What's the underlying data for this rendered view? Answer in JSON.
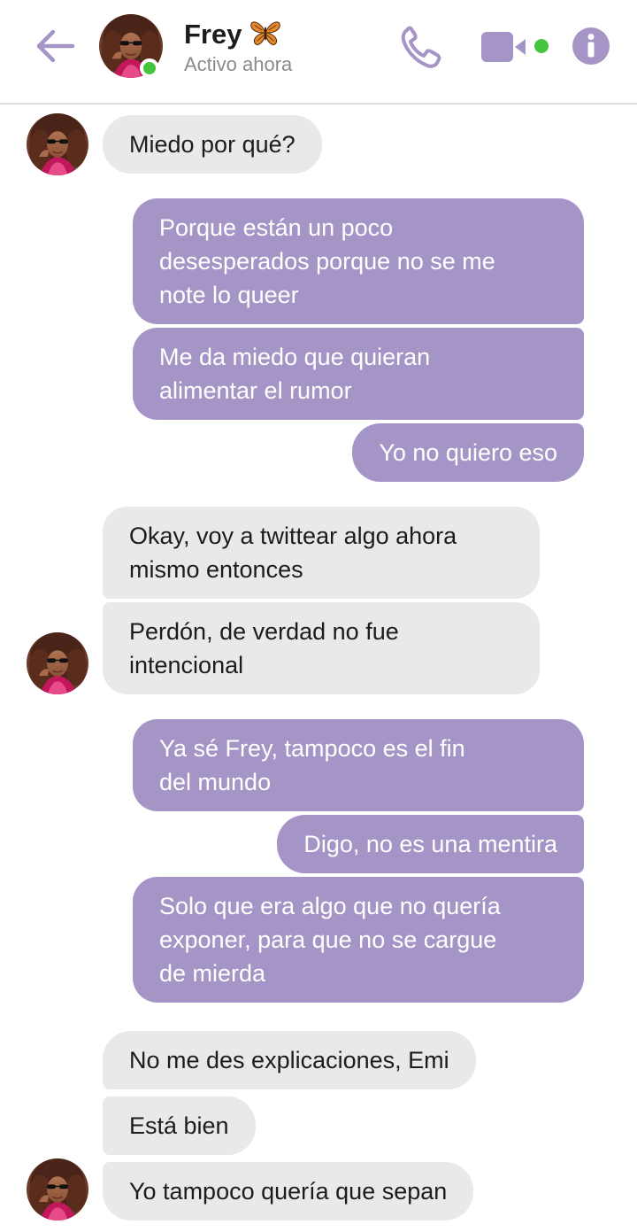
{
  "header": {
    "contact_name": "Frey",
    "status": "Activo ahora",
    "accent_color": "#a595c6",
    "online_color": "#45c43e",
    "icons": [
      "back-arrow-icon",
      "butterfly-icon",
      "phone-icon",
      "video-camera-icon",
      "info-icon"
    ]
  },
  "messages": [
    {
      "from": "contact",
      "lines": [
        "Miedo por qué?"
      ]
    },
    {
      "from": "me",
      "lines": [
        "Porque están un poco",
        "desesperados porque no se me",
        "note lo queer"
      ]
    },
    {
      "from": "me",
      "lines": [
        "Me da miedo que quieran",
        "alimentar el rumor"
      ]
    },
    {
      "from": "me",
      "lines": [
        "Yo no quiero eso"
      ]
    },
    {
      "from": "contact",
      "lines": [
        "Okay, voy a twittear algo ahora",
        "mismo entonces"
      ]
    },
    {
      "from": "contact",
      "lines": [
        "Perdón, de verdad no fue",
        "intencional"
      ]
    },
    {
      "from": "me",
      "lines": [
        "Ya sé Frey, tampoco es el fin",
        "del mundo"
      ]
    },
    {
      "from": "me",
      "lines": [
        "Digo, no es una mentira"
      ]
    },
    {
      "from": "me",
      "lines": [
        "Solo que era algo que no quería",
        "exponer, para que no se cargue",
        "de mierda"
      ]
    },
    {
      "from": "contact",
      "lines": [
        "No me des explicaciones, Emi"
      ]
    },
    {
      "from": "contact",
      "lines": [
        "Está bien"
      ]
    },
    {
      "from": "contact",
      "lines": [
        "Yo tampoco quería que sepan"
      ]
    }
  ]
}
